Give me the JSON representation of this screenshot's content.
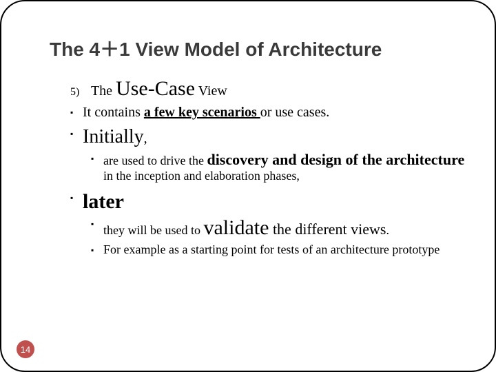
{
  "title": "The 4＋1 View Model of Architecture",
  "numbered": {
    "num": "5)",
    "pre": "The ",
    "big": "Use-Case",
    "post": " View"
  },
  "b1": {
    "pre": "It contains ",
    "u": "a few key scenarios ",
    "post": "or use cases."
  },
  "b2": {
    "text": "Initially",
    "comma": ","
  },
  "b2a": {
    "pre": "are used to drive the ",
    "strong": "discovery and design of the architecture",
    "post": " in the inception and elaboration phases,"
  },
  "b3": {
    "text": "later"
  },
  "b3a": {
    "pre": "they will be used to ",
    "strong": "validate",
    "mid": " the different views",
    "post": "."
  },
  "b3b": {
    "text": "For example as a starting point for tests of an architecture prototype"
  },
  "page": "14"
}
